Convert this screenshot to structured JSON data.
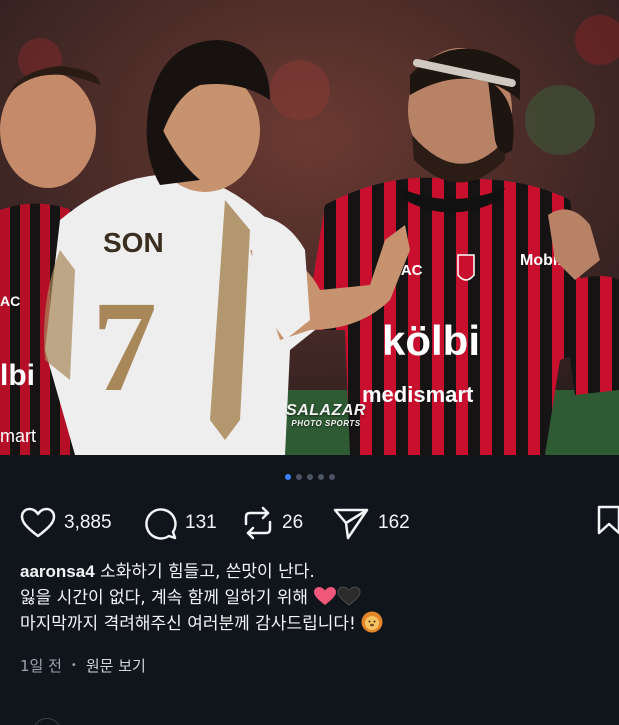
{
  "post": {
    "image_alt_watermark": {
      "main": "SALAZAR",
      "sub": "PHOTO SPORTS"
    },
    "jersey_texts": {
      "name": "SON",
      "number": "7",
      "sponsor_bac": "BAC",
      "sponsor_kolbi": "kölbi",
      "sponsor_medismart": "medismart",
      "sponsor_mobil": "Mobil",
      "left_kolbi_fragment": "lbi",
      "left_sponsor_fragment": "mart",
      "left_ac_fragment": "AC"
    },
    "carousel": {
      "total": 5,
      "active_index": 0
    }
  },
  "actions": {
    "like_count": "3,885",
    "comment_count": "131",
    "repost_count": "26",
    "share_count": "162"
  },
  "caption": {
    "username": "aaronsa4",
    "line1": "소화하기 힘들고, 쓴맛이 난다.",
    "line2": "잃을 시간이 없다, 계속 함께 일하기 위해",
    "line3": "마지막까지 격려해주신 여러분께 감사드립니다!"
  },
  "meta": {
    "time": "1일 전",
    "separator": "•",
    "translate_label": "원문 보기"
  },
  "colors": {
    "background": "#10141b",
    "accent_dot": "#3b82f6",
    "heart_pink": "#f0587b",
    "heart_black": "#2b2b2b",
    "jersey_red": "#c8102e",
    "jersey_black": "#111111",
    "jersey_white": "#eeeeee",
    "jersey_gold": "#a88758"
  },
  "icons": [
    "heart-icon",
    "comment-icon",
    "repost-icon",
    "share-icon",
    "bookmark-icon",
    "lion-emoji"
  ]
}
